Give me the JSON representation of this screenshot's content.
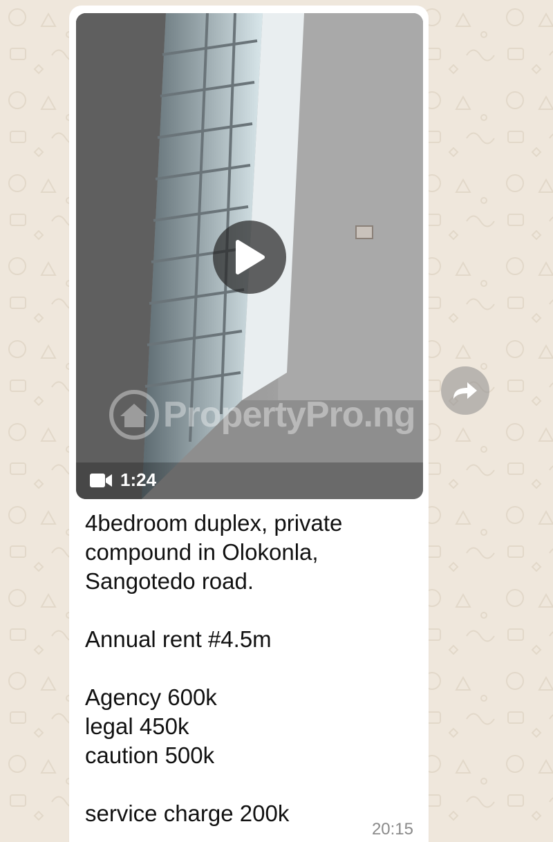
{
  "message": {
    "video": {
      "duration": "1:24",
      "watermark": "PropertyPro.ng",
      "icons": {
        "play": "play-icon",
        "camera": "video-camera-icon"
      }
    },
    "caption": {
      "lines": [
        "4bedroom duplex, private\ncompound in Olokonla,\nSangotedo road.",
        "Annual rent #4.5m",
        "Agency 600k\nlegal 450k\ncaution 500k",
        "service charge 200k"
      ]
    },
    "timestamp": "20:15"
  },
  "forward": {
    "icon": "forward-icon"
  },
  "colors": {
    "bubble": "#ffffff",
    "wallpaper": "#efe7dc",
    "text": "#111111",
    "timestamp": "#8a8a8a"
  }
}
